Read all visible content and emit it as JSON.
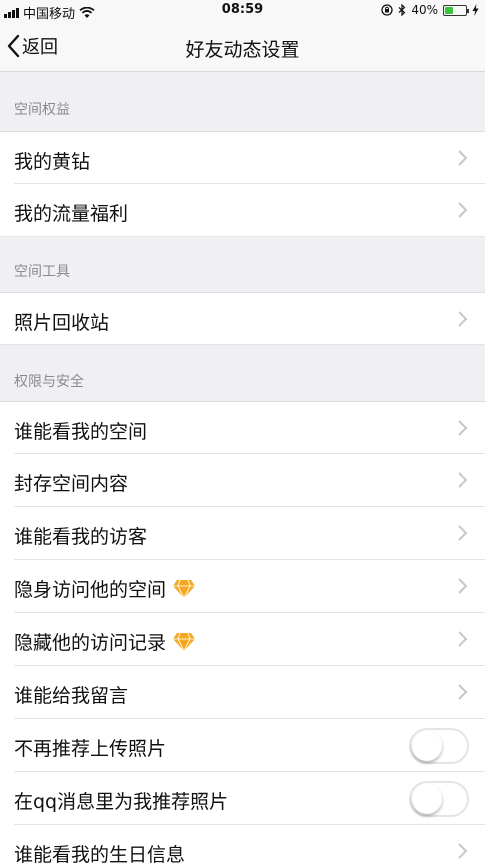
{
  "status_bar": {
    "carrier": "中国移动",
    "time": "08:59",
    "battery": "40%",
    "battery_level": 0.4
  },
  "nav": {
    "back_label": "返回",
    "title": "好友动态设置"
  },
  "sections": [
    {
      "header": "空间权益",
      "items": [
        {
          "label": "我的黄钻",
          "control": "chevron"
        },
        {
          "label": "我的流量福利",
          "control": "chevron"
        }
      ]
    },
    {
      "header": "空间工具",
      "items": [
        {
          "label": "照片回收站",
          "control": "chevron"
        }
      ]
    },
    {
      "header": "权限与安全",
      "items": [
        {
          "label": "谁能看我的空间",
          "control": "chevron"
        },
        {
          "label": "封存空间内容",
          "control": "chevron"
        },
        {
          "label": "谁能看我的访客",
          "control": "chevron"
        },
        {
          "label": "隐身访问他的空间",
          "control": "chevron",
          "badge": "diamond-icon"
        },
        {
          "label": "隐藏他的访问记录",
          "control": "chevron",
          "badge": "diamond-icon"
        },
        {
          "label": "谁能给我留言",
          "control": "chevron"
        },
        {
          "label": "不再推荐上传照片",
          "control": "toggle",
          "on": false
        },
        {
          "label": "在qq消息里为我推荐照片",
          "control": "toggle",
          "on": false
        },
        {
          "label": "谁能看我的生日信息",
          "control": "chevron"
        }
      ]
    }
  ],
  "colors": {
    "background": "#f0eff4",
    "section_header_text": "#8a8a8f",
    "chevron": "#c7c7cc",
    "battery_fill": "#3ac43a",
    "diamond": "#f5a623"
  }
}
